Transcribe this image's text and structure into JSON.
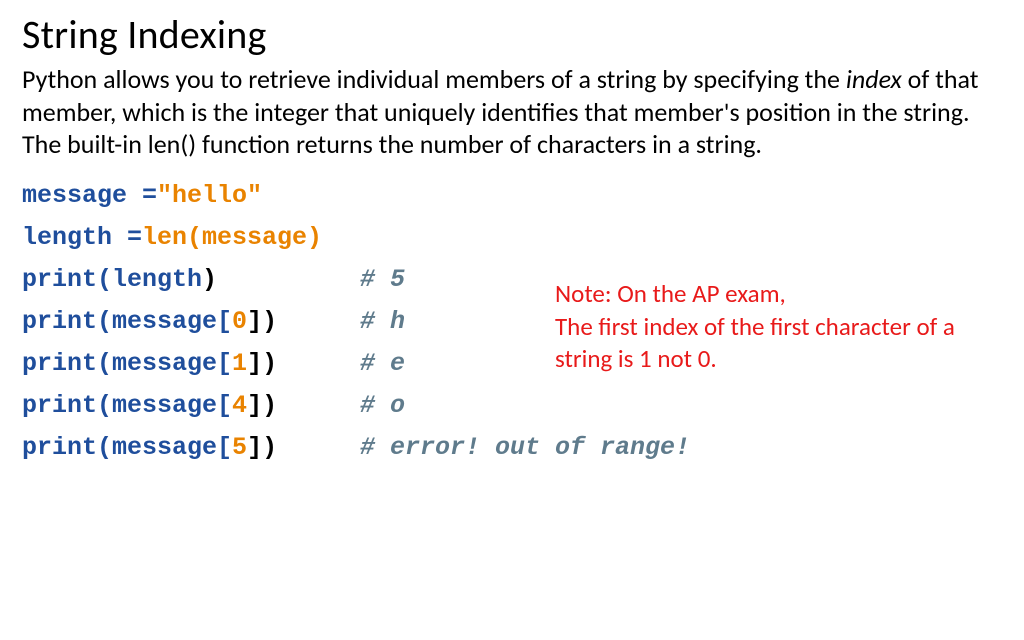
{
  "title": "String Indexing",
  "paragraph": {
    "part1": "Python allows you to retrieve individual members of a string by specifying the ",
    "italic": "index",
    "part2": " of that member, which is the integer that uniquely identifies that member's position in the string.  The built-in len() function returns the number of characters in a string."
  },
  "code": {
    "l1": {
      "a": "message = ",
      "b": "\"hello\""
    },
    "l2": {
      "a": "length = ",
      "b": "len(message)"
    },
    "l3": {
      "a": "print(length",
      "b": ")",
      "c": "# 5"
    },
    "l4": {
      "a": "print(message[",
      "b": "0",
      "c": "])",
      "d": "# h"
    },
    "l5": {
      "a": "print(message[",
      "b": "1",
      "c": "])",
      "d": "# e"
    },
    "l6": {
      "a": "print(message[",
      "b": "4",
      "c": "])",
      "d": "# o"
    },
    "l7": {
      "a": "print(message[",
      "b": "5",
      "c": "])",
      "d": "# error! out of range!"
    }
  },
  "note": {
    "line1": "Note: On the AP exam,",
    "line2": "The first index of the first character of a string is 1 not 0."
  }
}
